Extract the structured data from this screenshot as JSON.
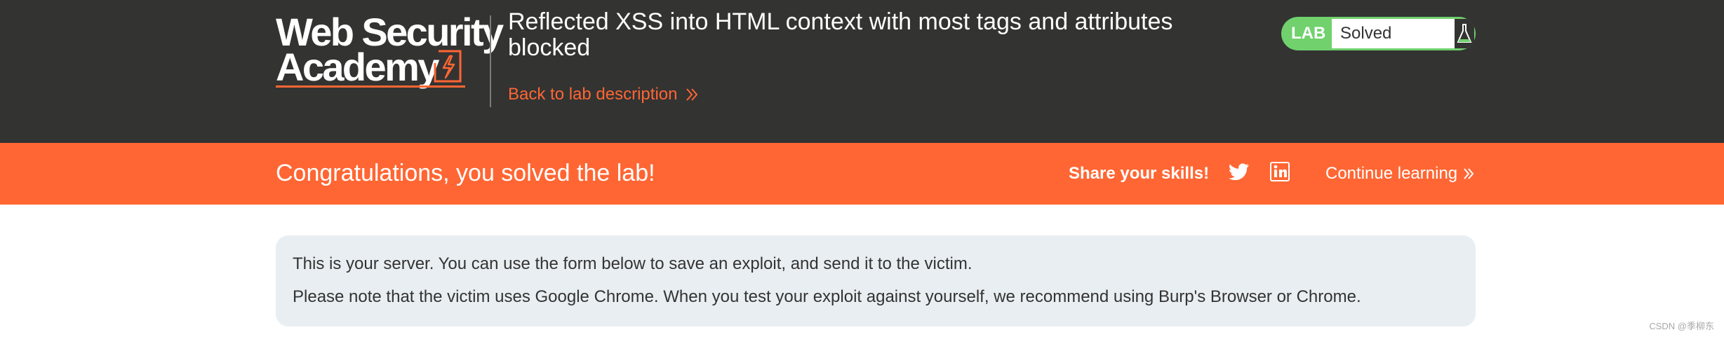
{
  "header": {
    "logo": {
      "line1": "Web Security",
      "line2": "Academy"
    },
    "lab_title": "Reflected XSS into HTML context with most tags and attributes blocked",
    "back_link": "Back to lab description",
    "status": {
      "tag": "LAB",
      "value": "Solved"
    }
  },
  "banner": {
    "message": "Congratulations, you solved the lab!",
    "share_label": "Share your skills!",
    "continue_label": "Continue learning"
  },
  "server_info": {
    "line1": "This is your server. You can use the form below to save an exploit, and send it to the victim.",
    "line2": "Please note that the victim uses Google Chrome. When you test your exploit against yourself, we recommend using Burp's Browser or Chrome."
  },
  "watermark": "CSDN @季柳东",
  "colors": {
    "header_bg": "#333332",
    "accent": "#ff6633",
    "status_green": "#70d16d",
    "info_bg": "#e8eef2"
  },
  "icons": [
    "zap-badge-icon",
    "double-chevron-right-icon",
    "flask-icon",
    "twitter-icon",
    "linkedin-icon"
  ]
}
